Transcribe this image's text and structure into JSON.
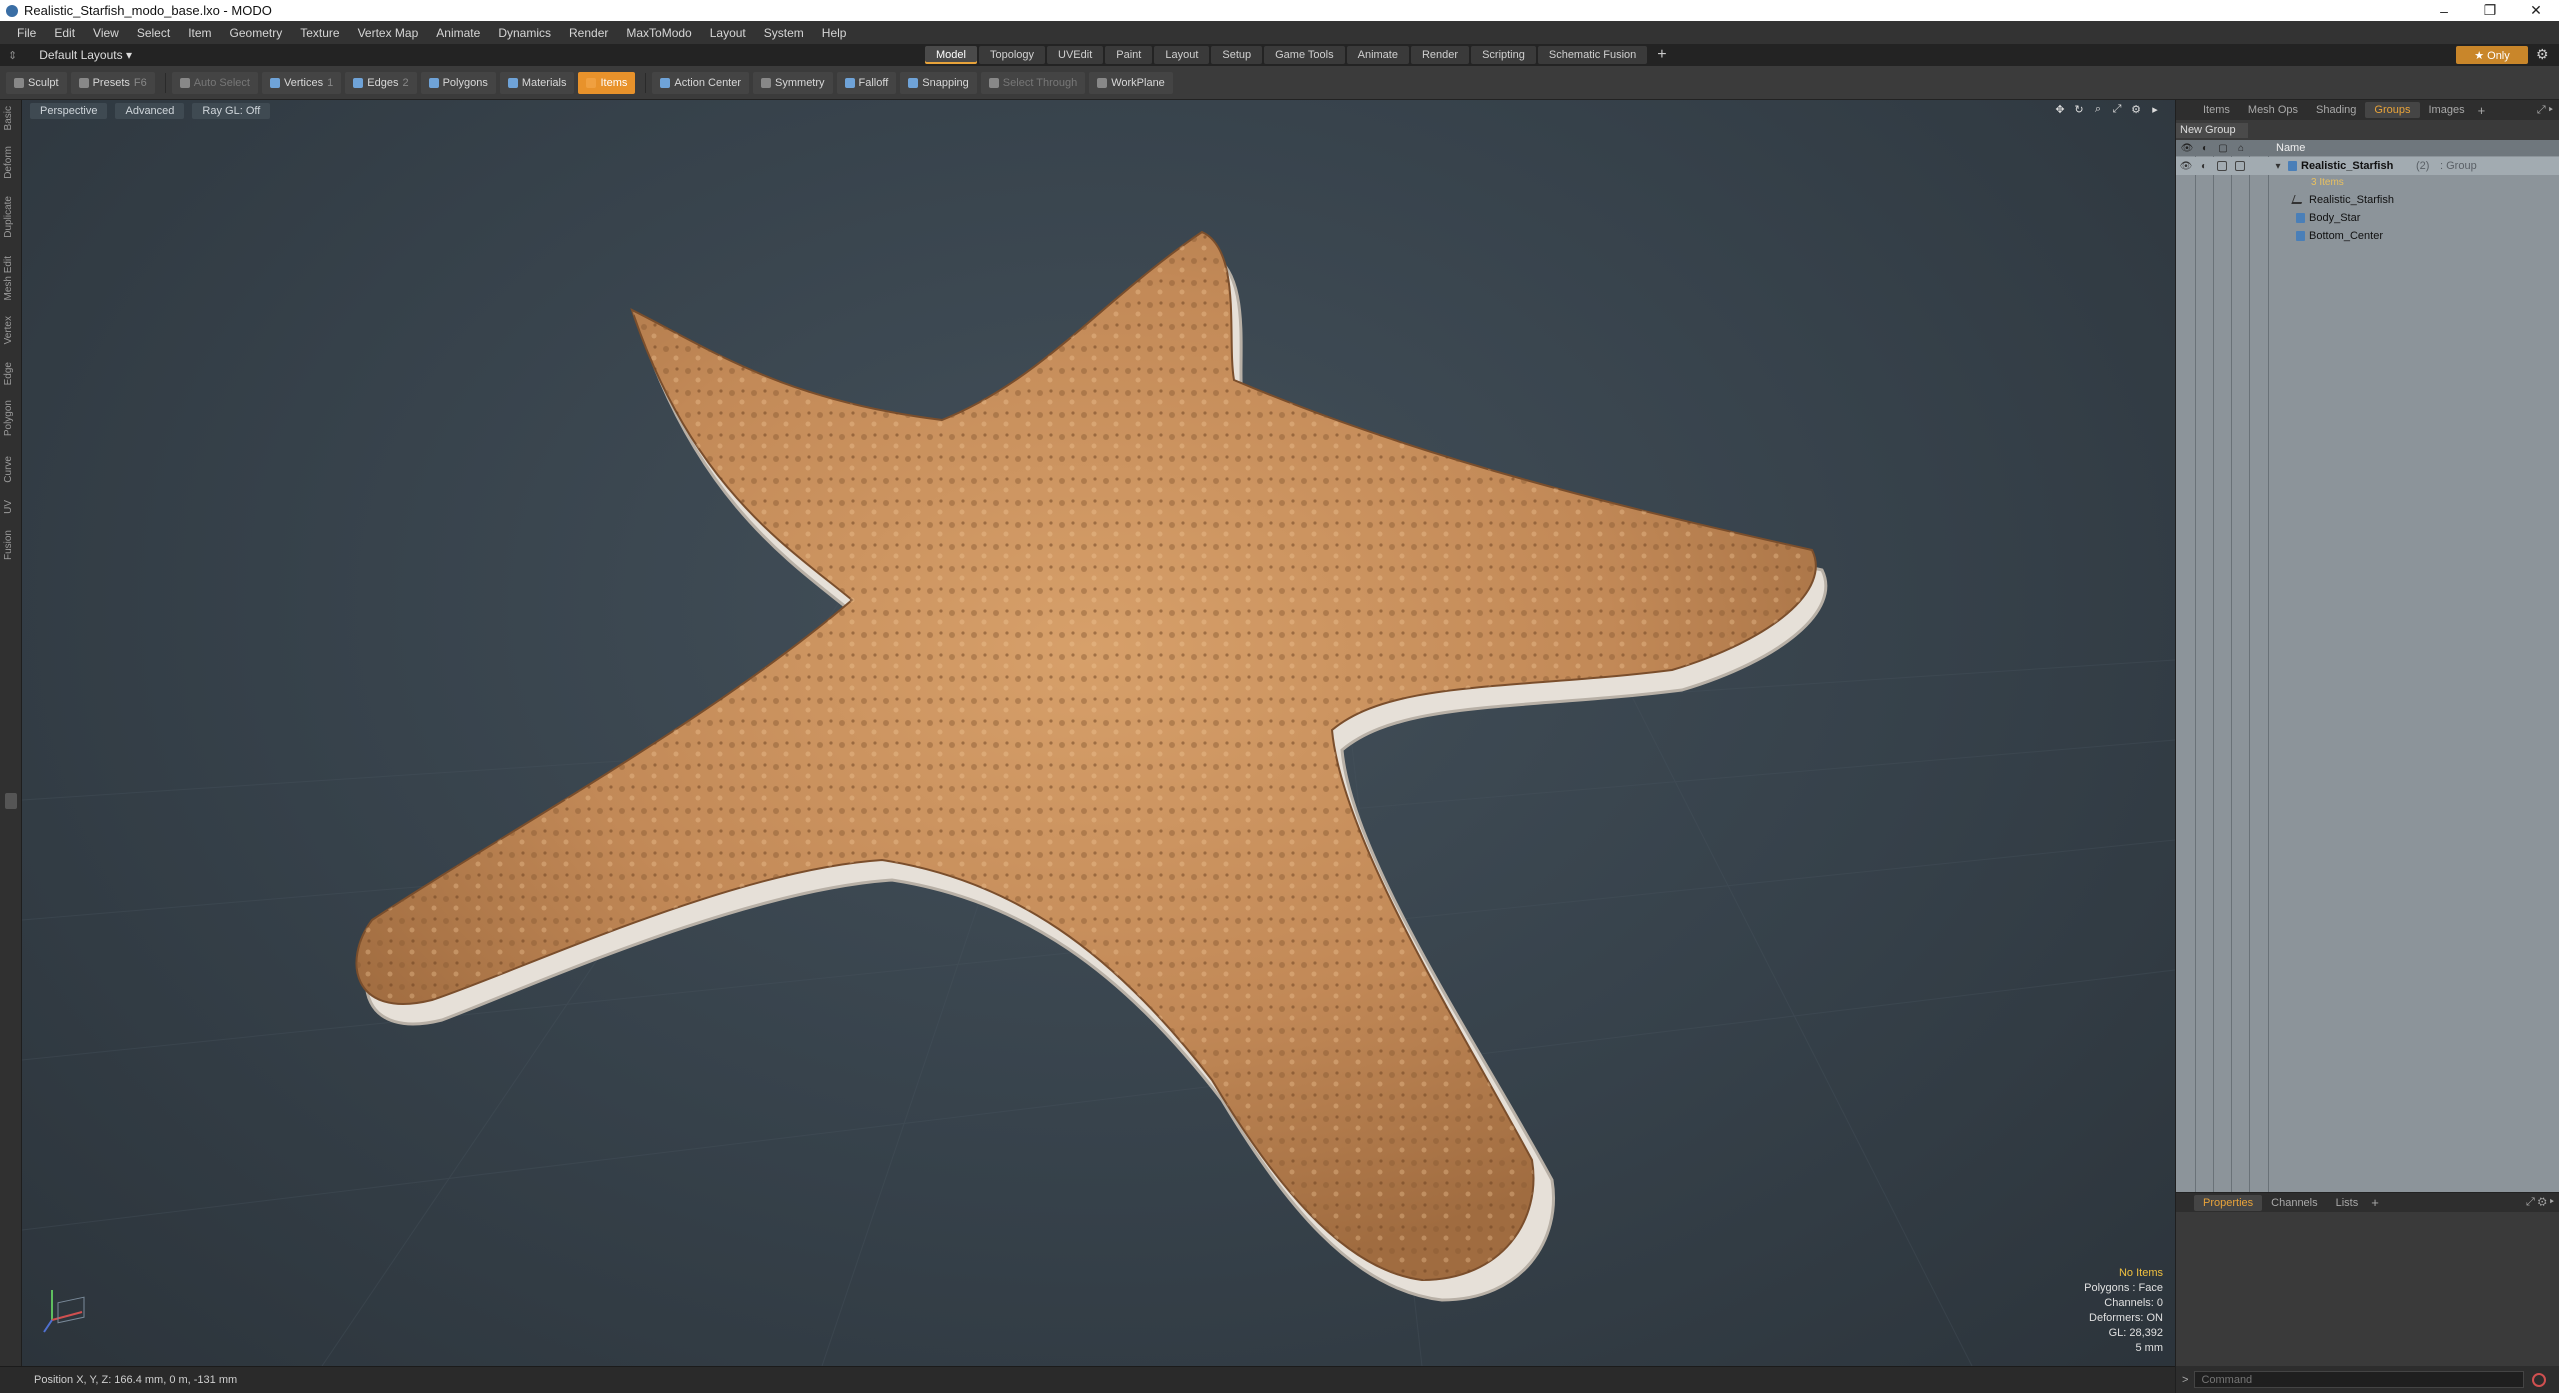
{
  "window": {
    "title": "Realistic_Starfish_modo_base.lxo - MODO",
    "controls": [
      "–",
      "❐",
      "✕"
    ]
  },
  "menubar": {
    "items": [
      "File",
      "Edit",
      "View",
      "Select",
      "Item",
      "Geometry",
      "Texture",
      "Vertex Map",
      "Animate",
      "Dynamics",
      "Render",
      "MaxToModo",
      "Layout",
      "System",
      "Help"
    ]
  },
  "layoutbar": {
    "layout_select": "Default Layouts ▾",
    "tabs": [
      "Model",
      "Topology",
      "UVEdit",
      "Paint",
      "Layout",
      "Setup",
      "Game Tools",
      "Animate",
      "Render",
      "Scripting",
      "Schematic Fusion"
    ],
    "active_tab": "Model",
    "add_tab": "+",
    "only_label": "★ Only",
    "gear": "⚙"
  },
  "toolbar": {
    "sculpt": "Sculpt",
    "presets": "Presets",
    "presets_key": "F6",
    "auto_select": "Auto Select",
    "vertices": "Vertices",
    "vertices_key": "1",
    "edges": "Edges",
    "edges_key": "2",
    "polygons": "Polygons",
    "materials": "Materials",
    "items": "Items",
    "action_center": "Action Center",
    "symmetry": "Symmetry",
    "falloff": "Falloff",
    "snapping": "Snapping",
    "select_through": "Select Through",
    "workplane": "WorkPlane"
  },
  "leftstrip": {
    "tabs": [
      "Basic",
      "Deform",
      "Duplicate",
      "Mesh Edit",
      "Vertex",
      "Edge",
      "Polygon",
      "Curve",
      "UV",
      "Fusion"
    ]
  },
  "viewport": {
    "view_mode": "Perspective",
    "shading": "Advanced",
    "raygl": "Ray GL: Off",
    "info": {
      "no_items": "No Items",
      "polygons": "Polygons : Face",
      "channels": "Channels: 0",
      "deformers": "Deformers: ON",
      "gl": "GL: 28,392",
      "scale": "5 mm"
    },
    "colors": {
      "starfish_top": "#c8915a",
      "starfish_shadow": "#8a5a34",
      "starfish_underside": "#e8e2da",
      "background": "#3a454d"
    }
  },
  "statusbar": {
    "position": "Position X, Y, Z:   166.4 mm, 0 m, -131 mm"
  },
  "rightpanel": {
    "tabs": [
      "Items",
      "Mesh Ops",
      "Shading",
      "Groups",
      "Images"
    ],
    "active_tab": "Groups",
    "add_tab": "+",
    "new_group": "New Group",
    "column_name": "Name",
    "group": {
      "name": "Realistic_Starfish",
      "count": "(2)",
      "type": ": Group",
      "items_count": "3 Items"
    },
    "items": [
      "Realistic_Starfish",
      "Body_Star",
      "Bottom_Center"
    ],
    "bottom_tabs": [
      "Properties",
      "Channels",
      "Lists"
    ],
    "bottom_active": "Properties",
    "command_placeholder": "Command"
  }
}
